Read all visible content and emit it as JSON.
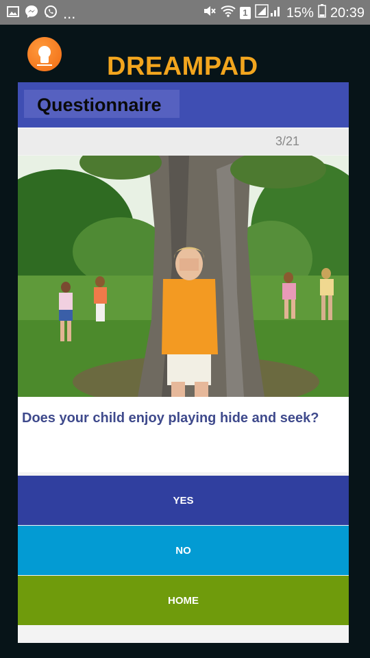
{
  "status_bar": {
    "battery": "15%",
    "time": "20:39",
    "notification_more": "...",
    "sim_indicator": "1",
    "icons": [
      "gallery-icon",
      "messenger-icon",
      "whatsapp-icon",
      "mute-icon",
      "wifi-icon",
      "signal-icon",
      "battery-icon"
    ]
  },
  "header": {
    "app_title": "DREAMPAD",
    "logo": "dreampad-logo",
    "accent_color": "#f2a51e"
  },
  "questionnaire": {
    "title": "Questionnaire",
    "progress": "3/21",
    "image": "child-hiding-behind-tree-photo",
    "question": "Does your child enjoy playing hide and seek?"
  },
  "buttons": {
    "yes": "YES",
    "no": "NO",
    "home": "HOME"
  },
  "colors": {
    "header_blue": "#3f4eb3",
    "yes_blue": "#303f9f",
    "no_cyan": "#039bd3",
    "home_green": "#6f9b0c",
    "background": "#071418"
  }
}
